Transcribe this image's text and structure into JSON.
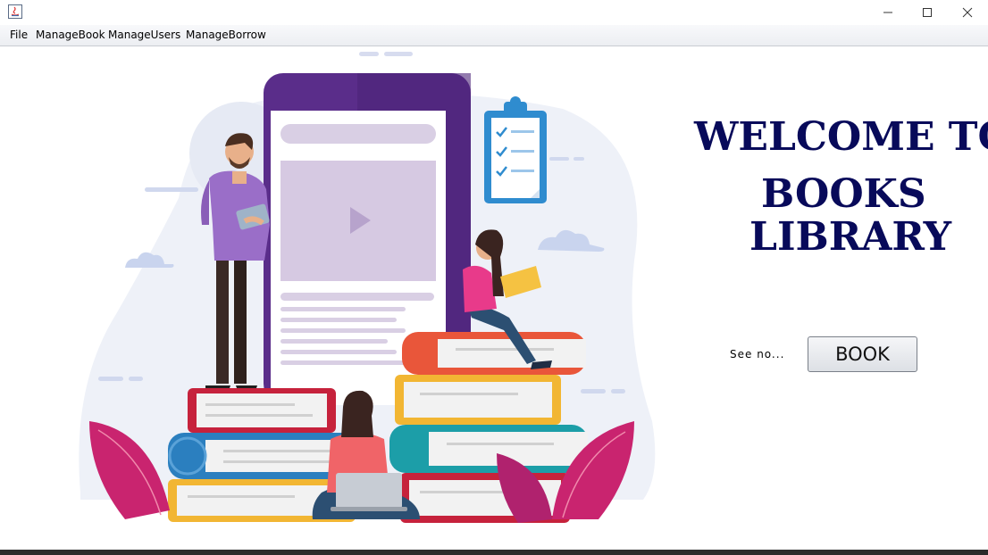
{
  "titlebar": {
    "icons": {
      "app": "java-app-icon",
      "minimize": "minimize-icon",
      "maximize": "maximize-icon",
      "close": "close-icon"
    }
  },
  "menu": {
    "items": [
      "File",
      "ManageBook",
      "ManageUsers",
      "ManageBorrow"
    ]
  },
  "welcome": {
    "line1": "WELCOME TO",
    "line2": "BOOKS",
    "line3": "LIBRARY",
    "color": "#080a5a"
  },
  "see_label": "See no...",
  "book_button_label": "BOOK",
  "illustration": {
    "name": "library-illustration"
  }
}
